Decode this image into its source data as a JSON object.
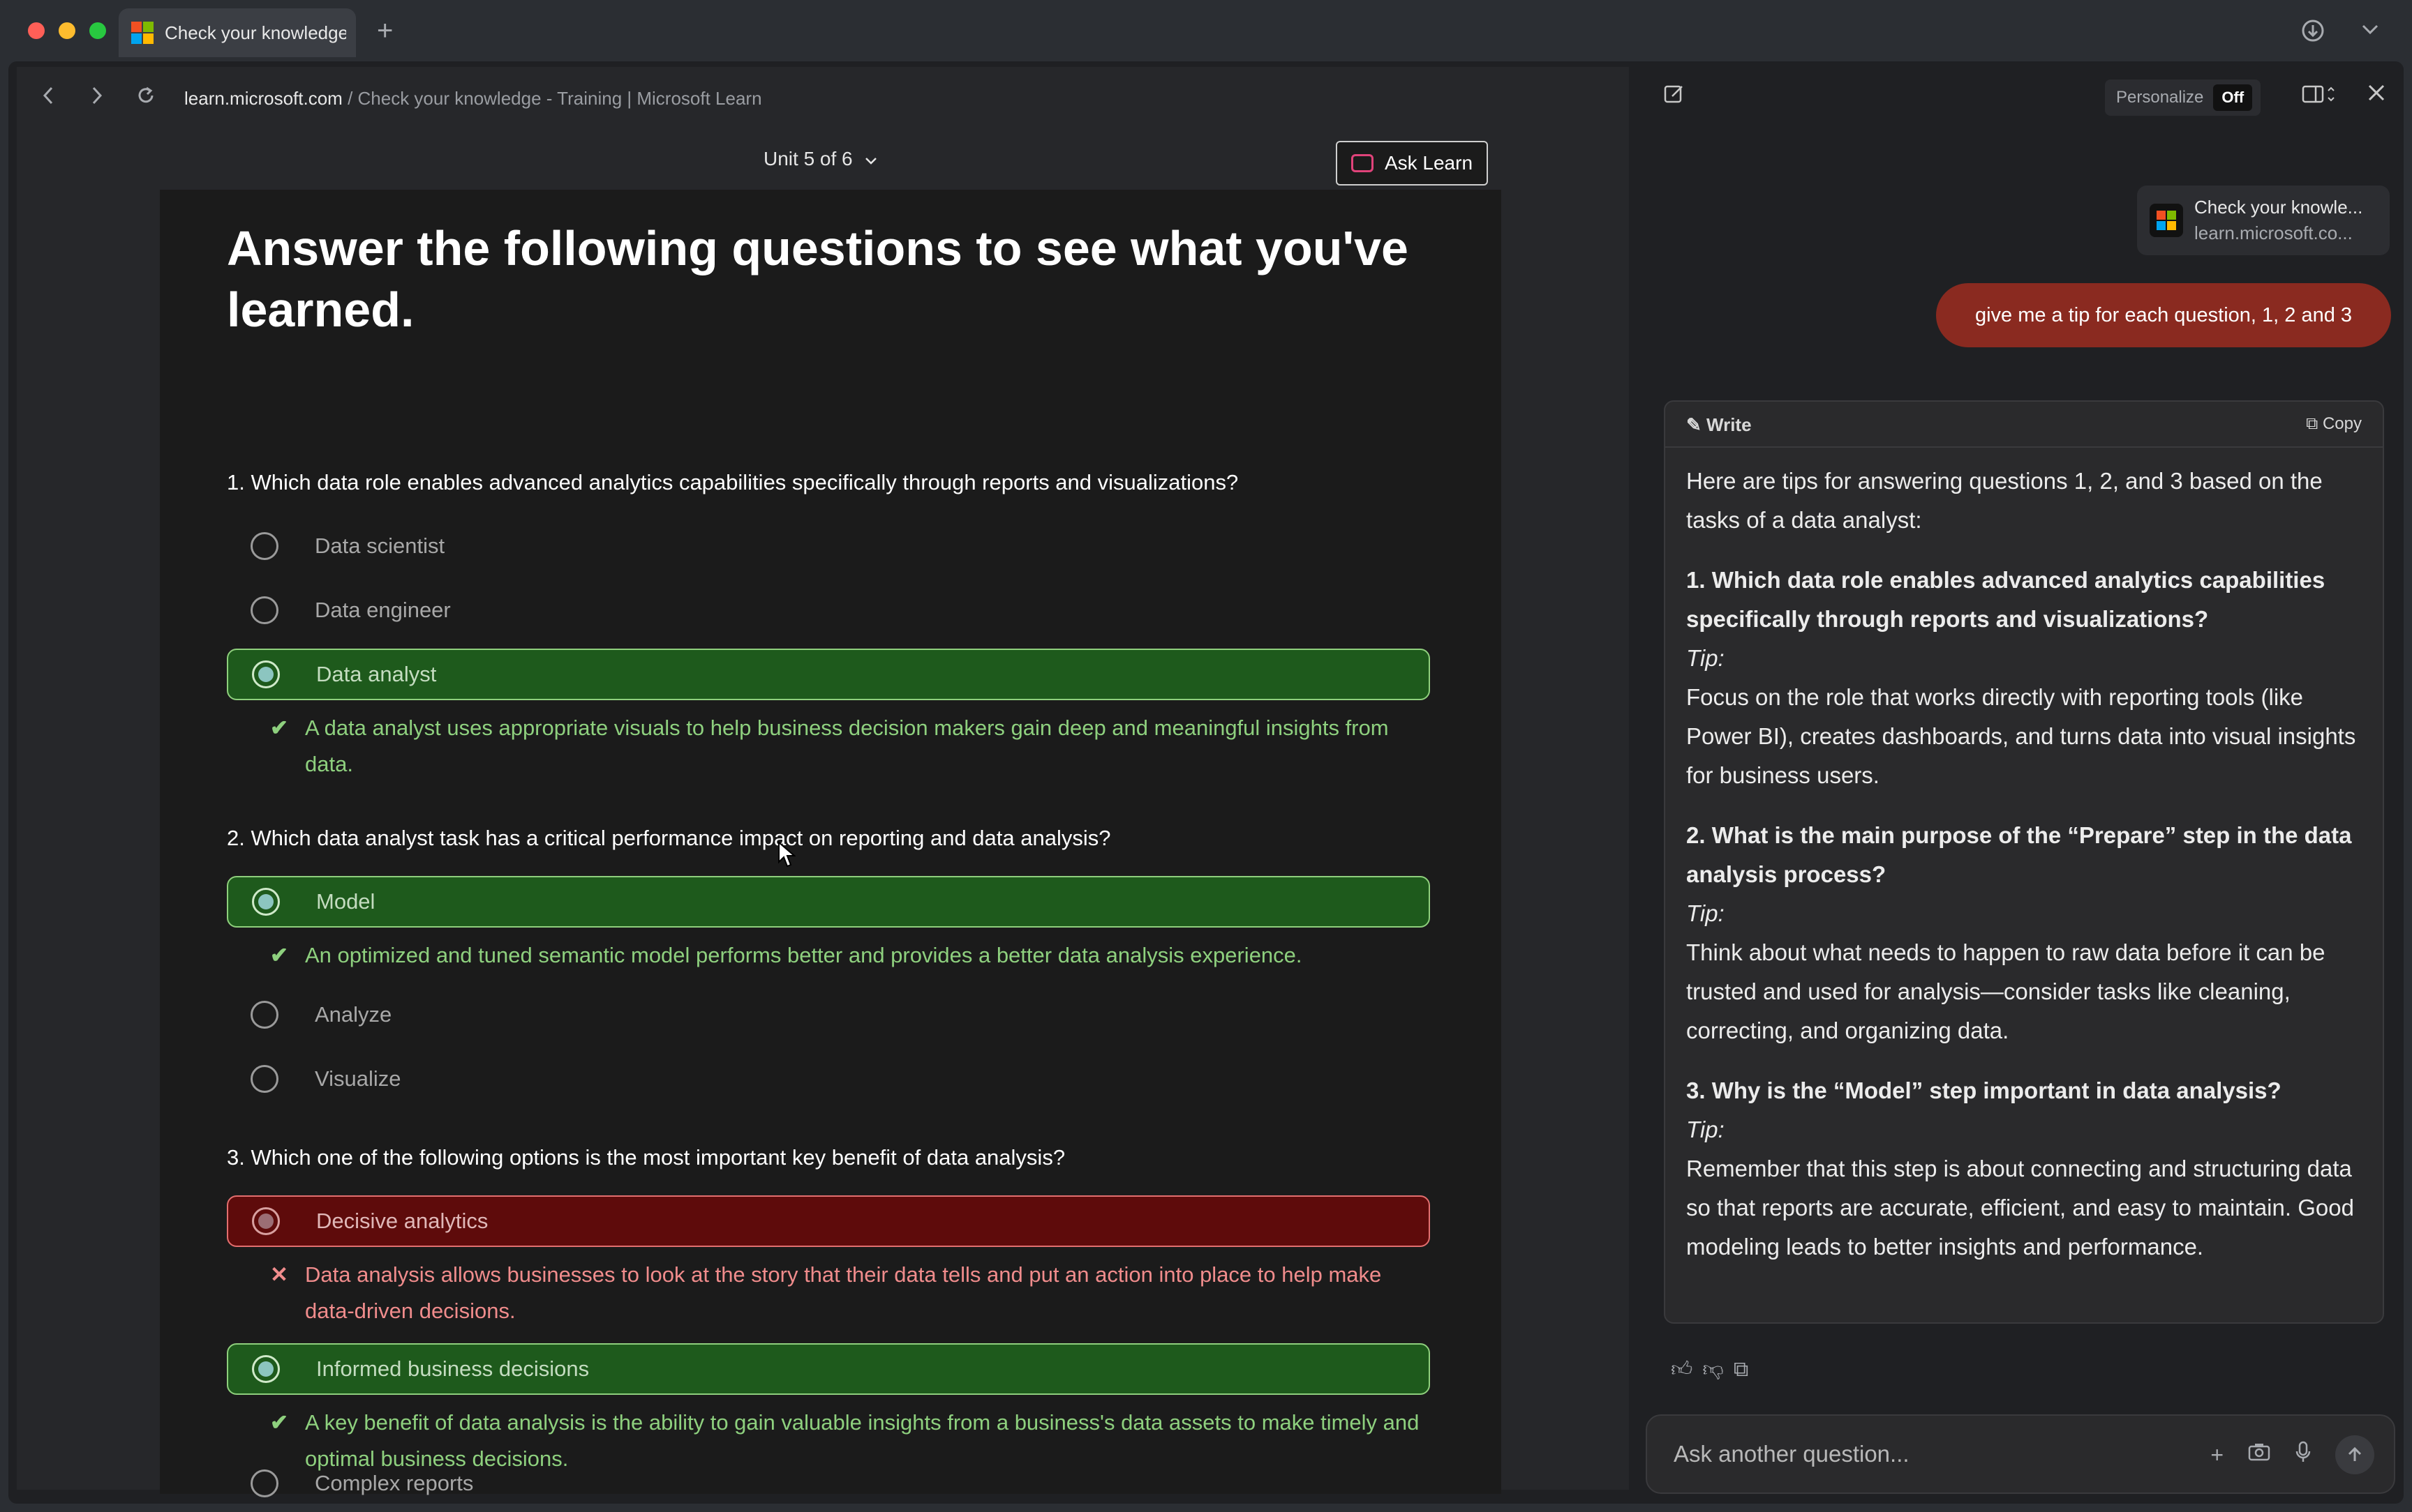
{
  "browser": {
    "tab_title": "Check your knowledge",
    "new_tab": "+",
    "url_domain": "learn.microsoft.com",
    "url_rest": " / Check your knowledge - Training | Microsoft Learn"
  },
  "page": {
    "unit_selector": "Unit 5 of 6",
    "ask_learn": "Ask Learn",
    "heading": "Answer the following questions to see what you've learned.",
    "questions": [
      {
        "text": "1. Which data role enables advanced analytics capabilities specifically through reports and visualizations?",
        "options": [
          "Data scientist",
          "Data engineer",
          "Data analyst"
        ],
        "feedback": "A data analyst uses appropriate visuals to help business decision makers gain deep and meaningful insights from data."
      },
      {
        "text": "2. Which data analyst task has a critical performance impact on reporting and data analysis?",
        "options": [
          "Model",
          "Analyze",
          "Visualize"
        ],
        "feedback": "An optimized and tuned semantic model performs better and provides a better data analysis experience."
      },
      {
        "text": "3. Which one of the following options is the most important key benefit of data analysis?",
        "options": [
          "Decisive analytics",
          "Informed business decisions",
          "Complex reports"
        ],
        "feedback_wrong": "Data analysis allows businesses to look at the story that their data tells and put an action into place to help make data-driven decisions.",
        "feedback": "A key benefit of data analysis is the ability to gain valuable insights from a business's data assets to make timely and optimal business decisions."
      }
    ]
  },
  "sidebar": {
    "personalize": "Personalize",
    "toggle": "Off",
    "context_title": "Check your knowle...",
    "context_url": "learn.microsoft.co...",
    "user_message": "give me a tip for each question, 1, 2 and 3",
    "answer_mode": "Write",
    "copy": "Copy",
    "answer_intro": "Here are tips for answering questions 1, 2, and 3 based on the tasks of a data analyst:",
    "tips": [
      {
        "q": "1. Which data role enables advanced analytics capabilities specifically through reports and visualizations?",
        "tip_label": "Tip:",
        "tip": "Focus on the role that works directly with reporting tools (like Power BI), creates dashboards, and turns data into visual insights for business users."
      },
      {
        "q": "2. What is the main purpose of the “Prepare” step in the data analysis process?",
        "tip_label": "Tip:",
        "tip": "Think about what needs to happen to raw data before it can be trusted and used for analysis—consider tasks like cleaning, correcting, and organizing data."
      },
      {
        "q": "3. Why is the “Model” step important in data analysis?",
        "tip_label": "Tip:",
        "tip": "Remember that this step is about connecting and structuring data so that reports are accurate, efficient, and easy to maintain. Good modeling leads to better insights and performance."
      }
    ],
    "input_placeholder": "Ask another question..."
  }
}
